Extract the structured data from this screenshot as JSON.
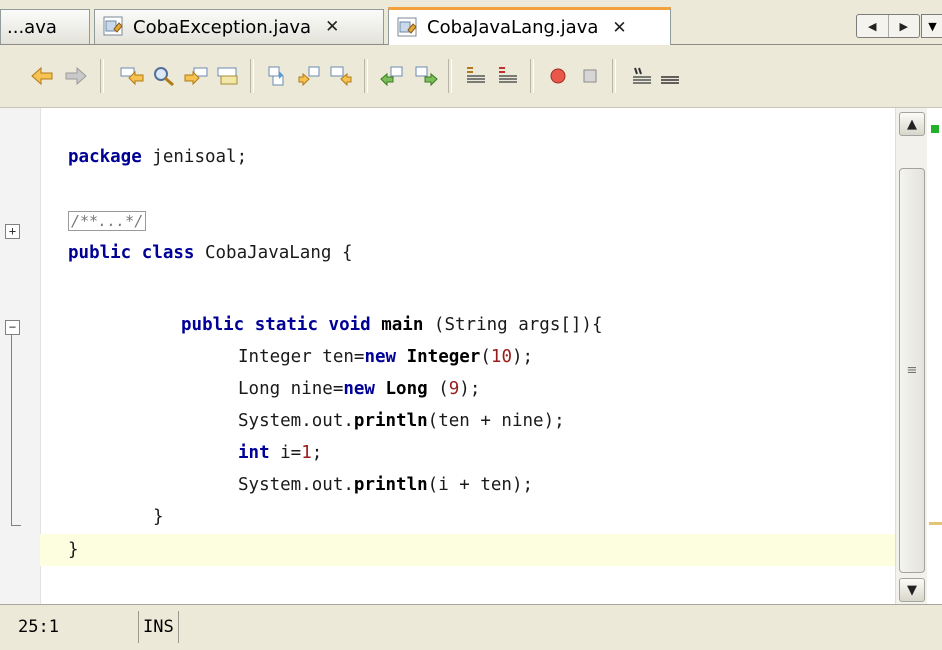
{
  "tabs": [
    {
      "label": "...ava",
      "active": false
    },
    {
      "label": "CobaException.java",
      "close": "✕",
      "active": false
    },
    {
      "label": "CobaJavaLang.java",
      "close": "✕",
      "active": true
    }
  ],
  "tab_scroll": {
    "left": "◀",
    "right": "▶",
    "dropdown": "▼"
  },
  "toolbar_icons": [
    "back-icon",
    "forward-icon",
    "find-prev-icon",
    "find-icon",
    "find-next-icon",
    "toggle-highlight-icon",
    "prev-bookmark-icon",
    "next-bookmark-icon",
    "toggle-bookmark-icon",
    "shift-left-icon",
    "shift-right-icon",
    "comment-icon",
    "uncomment-icon",
    "record-macro-icon",
    "stop-macro-icon",
    "format-icon",
    "align-icon"
  ],
  "code": {
    "package_kw": "package",
    "package_name": " jenisoal;",
    "javadoc_collapsed": "/**...*/",
    "class_decl": {
      "kw1": "public",
      "kw2": "class",
      "rest": " CobaJavaLang {"
    },
    "main_decl": {
      "kw1": "public",
      "kw2": "static",
      "kw3": "void",
      "name": "main",
      "rest": " (String args[]){"
    },
    "l1": {
      "a": "Integer ten=",
      "kw": "new",
      "cls": "Integer",
      "p1": "(",
      "num": "10",
      "p2": ");"
    },
    "l2": {
      "a": "Long nine=",
      "kw": "new",
      "cls": "Long",
      "p1": " (",
      "num": "9",
      "p2": ");"
    },
    "l3": {
      "a": "System.out.",
      "m": "println",
      "b": "(ten + nine);"
    },
    "l4": {
      "kw": "int",
      "a": " i=",
      "num": "1",
      "b": ";"
    },
    "l5": {
      "a": "System.out.",
      "m": "println",
      "b": "(i + ten);"
    },
    "close_method": "}",
    "close_class": "}"
  },
  "fold": {
    "expand": "+",
    "collapse": "−"
  },
  "scrollbar": {
    "up": "▲",
    "down": "▼",
    "grip": "≡"
  },
  "status": {
    "position": "25:1",
    "mode": "INS"
  }
}
